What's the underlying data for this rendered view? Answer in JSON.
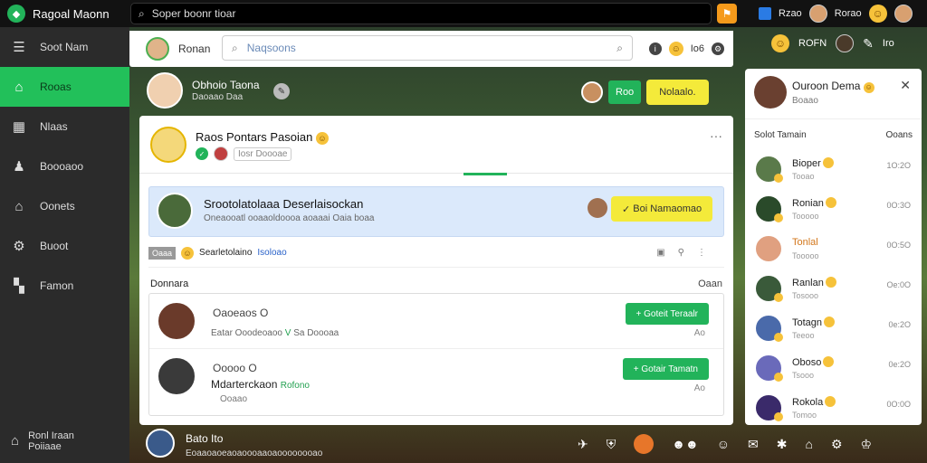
{
  "app": {
    "name": "Ragoal Maonn"
  },
  "topbar": {
    "search": "Soper boonr tioar",
    "right_label_1": "Rzao",
    "right_label_2": "Rorao"
  },
  "sidebar": {
    "items": [
      {
        "label": "Soot Nam",
        "icon": "menu-icon"
      },
      {
        "label": "Rooas",
        "icon": "home-icon",
        "active": true
      },
      {
        "label": "Nlaas",
        "icon": "building-icon"
      },
      {
        "label": "Boooaoo",
        "icon": "users-icon"
      },
      {
        "label": "Oonets",
        "icon": "bank-icon"
      },
      {
        "label": "Buoot",
        "icon": "gear-icon"
      },
      {
        "label": "Famon",
        "icon": "grid-icon"
      }
    ],
    "bottom": {
      "line1": "Ronl Iraan",
      "line2": "Poiiaae"
    }
  },
  "subhead": {
    "name": "Ronan",
    "search": "Naqsoons",
    "count": "Io6"
  },
  "right_top": {
    "label": "ROFN",
    "label2": "Iro"
  },
  "channel": {
    "title": "Obhoio Taona",
    "subtitle": "Daoaao Daa"
  },
  "green_pill": {
    "button": "Roo",
    "bubble": "Nolaalo."
  },
  "card": {
    "title": "Raos Pontars Pasoian",
    "meta": "Iosr Doooae",
    "post": {
      "title": "Srootolatolaaa Deserlaisockan",
      "subtitle": "Oneaooatl ooaaoldoooa aoaaai Oaia boaa",
      "button": "Boi Namaomao"
    },
    "reply": {
      "chip": "Oaaa",
      "text": "Searletolaino",
      "link": "Isoloao"
    },
    "section": {
      "label": "Donnara",
      "right": "Oaan"
    },
    "rows": [
      {
        "name": "Oaoeaos  O",
        "detail": "Eatar  Ooodeoaoo",
        "tag": "V",
        "extra": "Sa Doooaa",
        "action": "Goteit Teraalr",
        "x": "Ao"
      },
      {
        "name": "Ooooo  O",
        "detail": "Mdarterckaon",
        "tag": "Rofono",
        "extra": "Ooaao",
        "action": "Gotair Tamatn",
        "x": "Ao"
      }
    ]
  },
  "rpanel": {
    "title": "Ouroon Dema",
    "subtitle": "Boaao",
    "header_left": "Solot Tamain",
    "header_right": "Ooans",
    "items": [
      {
        "name": "Bioper",
        "sub": "Tooao",
        "time": "1O:2O"
      },
      {
        "name": "Ronian",
        "sub": "Tooooo",
        "time": "0O:3O"
      },
      {
        "name": "Tonlal",
        "sub": "Tooooo",
        "time": "0O:5O",
        "orange": true
      },
      {
        "name": "Ranlan",
        "sub": "Tosooo",
        "time": "Oe:0O"
      },
      {
        "name": "Totagn",
        "sub": "Teeoo",
        "time": "0e:2O"
      },
      {
        "name": "Oboso",
        "sub": "Tsooo",
        "time": "0e:2O"
      },
      {
        "name": "Rokola",
        "sub": "Tomoo",
        "time": "0O:0O"
      }
    ]
  },
  "bottom": {
    "name": "Bato  Ito",
    "status": "Eoaaoaoeaoaoooaaoaoooooooao"
  },
  "colors": {
    "accent": "#22c05a",
    "sidebar": "#2b2b2b",
    "highlight": "#f4ea3a"
  }
}
